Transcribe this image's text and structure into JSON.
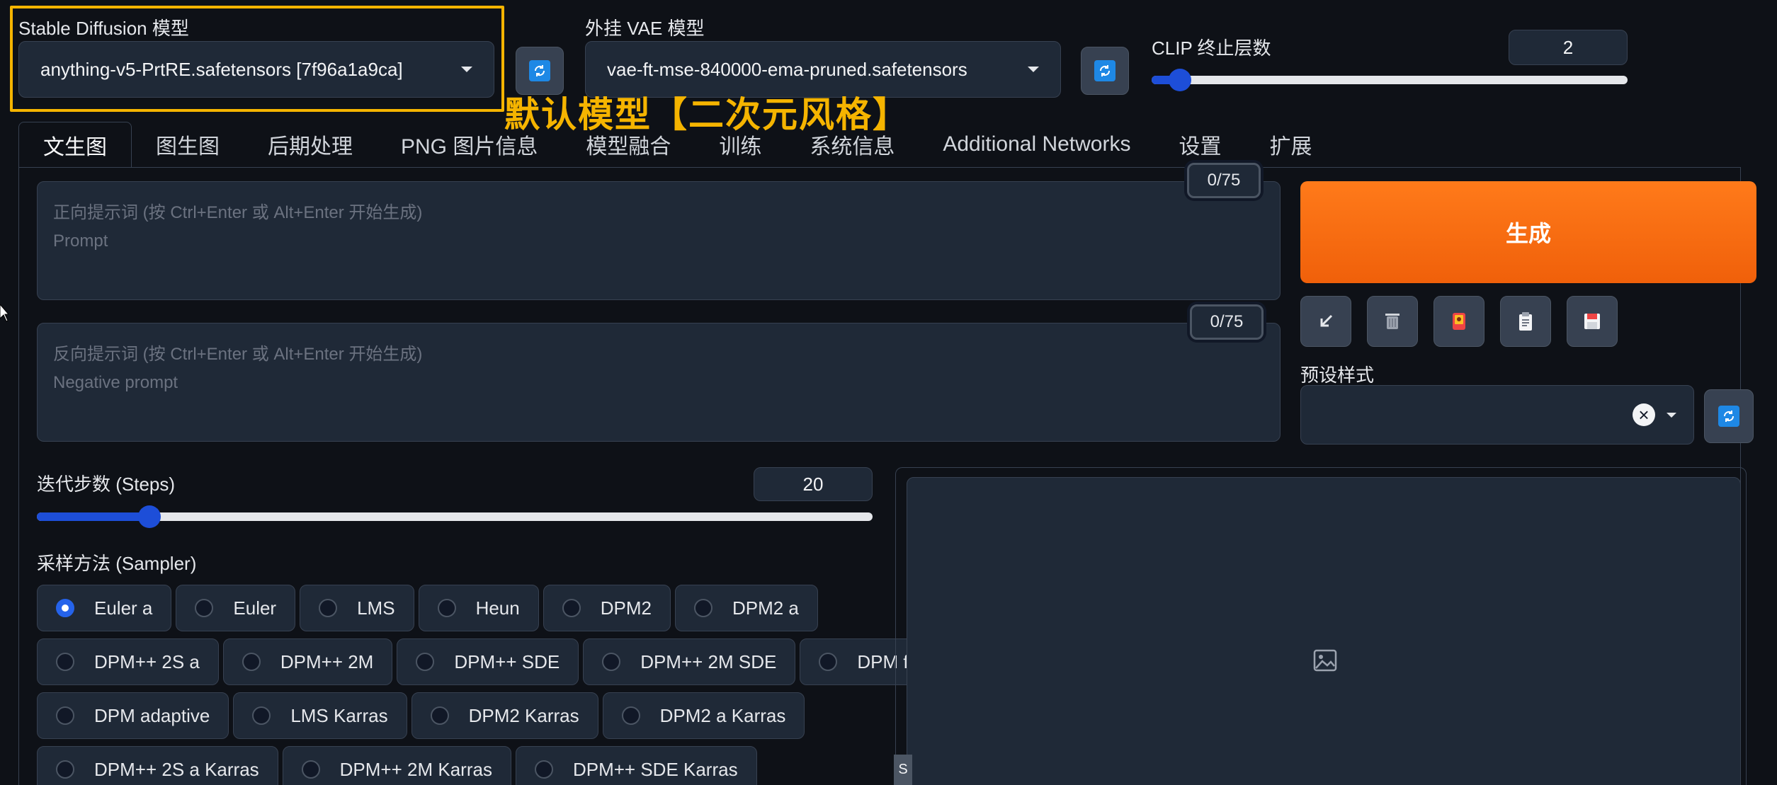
{
  "sd_model": {
    "label": "Stable Diffusion 模型",
    "value": "anything-v5-PrtRE.safetensors [7f96a1a9ca]"
  },
  "vae_model": {
    "label": "外挂 VAE 模型",
    "value": "vae-ft-mse-840000-ema-pruned.safetensors"
  },
  "clip": {
    "label": "CLIP 终止层数",
    "value": "2",
    "slider_fraction": 0.06
  },
  "overlay_caption": "默认模型【二次元风格】",
  "tabs": [
    {
      "label": "文生图",
      "active": true
    },
    {
      "label": "图生图"
    },
    {
      "label": "后期处理"
    },
    {
      "label": "PNG 图片信息"
    },
    {
      "label": "模型融合"
    },
    {
      "label": "训练"
    },
    {
      "label": "系统信息"
    },
    {
      "label": "Additional Networks"
    },
    {
      "label": "设置"
    },
    {
      "label": "扩展"
    }
  ],
  "prompt": {
    "placeholder_line1": "正向提示词 (按 Ctrl+Enter 或 Alt+Enter 开始生成)",
    "placeholder_line2": "Prompt",
    "counter": "0/75"
  },
  "negative_prompt": {
    "placeholder_line1": "反向提示词 (按 Ctrl+Enter 或 Alt+Enter 开始生成)",
    "placeholder_line2": "Negative prompt",
    "counter": "0/75"
  },
  "generate_label": "生成",
  "tool_buttons": [
    {
      "icon": "arrow-down-left-icon",
      "color": "#e5e7eb"
    },
    {
      "icon": "trash-icon",
      "color": "#9ca3af"
    },
    {
      "icon": "red-card-icon",
      "color": "#ef4444"
    },
    {
      "icon": "clipboard-icon",
      "color": "#f3f4f6"
    },
    {
      "icon": "save-icon",
      "color": "#f3f4f6"
    }
  ],
  "styles": {
    "label": "预设样式",
    "clear_glyph": "×"
  },
  "steps": {
    "label": "迭代步数 (Steps)",
    "value": "20",
    "slider_fraction": 0.135
  },
  "sampler": {
    "label": "采样方法 (Sampler)",
    "rows": [
      [
        "Euler a",
        "Euler",
        "LMS",
        "Heun",
        "DPM2",
        "DPM2 a"
      ],
      [
        "DPM++ 2S a",
        "DPM++ 2M",
        "DPM++ SDE",
        "DPM++ 2M SDE",
        "DPM fast"
      ],
      [
        "DPM adaptive",
        "LMS Karras",
        "DPM2 Karras",
        "DPM2 a Karras"
      ],
      [
        "DPM++ 2S a Karras",
        "DPM++ 2M Karras",
        "DPM++ SDE Karras"
      ]
    ],
    "selected": "Euler a"
  },
  "bottom_marker": "S",
  "colors": {
    "accent": "#1d4ed8",
    "highlight": "#f5b400",
    "generate": "#f56a0e",
    "background": "#0e1117"
  }
}
